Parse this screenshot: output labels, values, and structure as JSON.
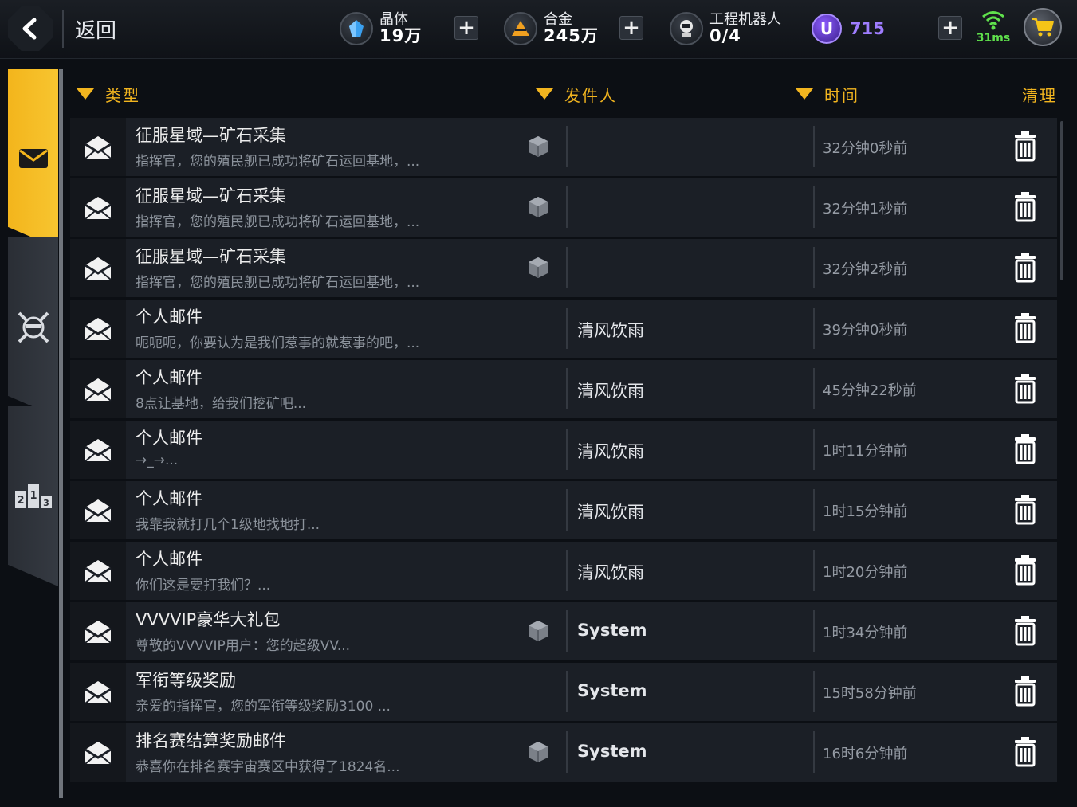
{
  "topbar": {
    "back_label": "返回",
    "crystal": {
      "name": "晶体",
      "value": "19万"
    },
    "alloy": {
      "name": "合金",
      "value": "245万"
    },
    "robot": {
      "name": "工程机器人",
      "value": "0/4"
    },
    "premium": {
      "icon_letter": "U",
      "value": "715"
    },
    "ping": "31ms",
    "colors": {
      "crystal": "#3aa0f0",
      "alloy": "#f0a020",
      "premium": "#9f7dff",
      "ping": "#5fe04c"
    }
  },
  "tabs": [
    {
      "icon": "envelope-icon",
      "active": true
    },
    {
      "icon": "crossed-swords-helmet-icon",
      "active": false
    },
    {
      "icon": "podium-rank-icon",
      "active": false
    }
  ],
  "header": {
    "type": "类型",
    "sender": "发件人",
    "time": "时间",
    "clear": "清理",
    "accent": "#f2b51f"
  },
  "mails": [
    {
      "subject": "征服星域—矿石采集",
      "preview": "指挥官，您的殖民舰已成功将矿石运回基地，...",
      "sender": "",
      "time": "32分钟0秒前",
      "attachment": true,
      "system": false
    },
    {
      "subject": "征服星域—矿石采集",
      "preview": "指挥官，您的殖民舰已成功将矿石运回基地，...",
      "sender": "",
      "time": "32分钟1秒前",
      "attachment": true,
      "system": false
    },
    {
      "subject": "征服星域—矿石采集",
      "preview": "指挥官，您的殖民舰已成功将矿石运回基地，...",
      "sender": "",
      "time": "32分钟2秒前",
      "attachment": true,
      "system": false
    },
    {
      "subject": "个人邮件",
      "preview": "呃呃呃，你要认为是我们惹事的就惹事的吧，...",
      "sender": "清风饮雨",
      "time": "39分钟0秒前",
      "attachment": false,
      "system": false
    },
    {
      "subject": "个人邮件",
      "preview": "8点让基地，给我们挖矿吧...",
      "sender": "清风饮雨",
      "time": "45分钟22秒前",
      "attachment": false,
      "system": false
    },
    {
      "subject": "个人邮件",
      "preview": "→_→...",
      "sender": "清风饮雨",
      "time": "1时11分钟前",
      "attachment": false,
      "system": false
    },
    {
      "subject": "个人邮件",
      "preview": "我靠我就打几个1级地找地打...",
      "sender": "清风饮雨",
      "time": "1时15分钟前",
      "attachment": false,
      "system": false
    },
    {
      "subject": "个人邮件",
      "preview": "你们这是要打我们？...",
      "sender": "清风饮雨",
      "time": "1时20分钟前",
      "attachment": false,
      "system": false
    },
    {
      "subject": "VVVVIP豪华大礼包",
      "preview": "尊敬的VVVVIP用户：您的超级VV...",
      "sender": "System",
      "time": "1时34分钟前",
      "attachment": true,
      "system": true
    },
    {
      "subject": "军衔等级奖励",
      "preview": "亲爱的指挥官，您的军衔等级奖励3100 ...",
      "sender": "System",
      "time": "15时58分钟前",
      "attachment": false,
      "system": true
    },
    {
      "subject": "排名赛结算奖励邮件",
      "preview": "恭喜你在排名赛宇宙赛区中获得了1824名...",
      "sender": "System",
      "time": "16时6分钟前",
      "attachment": true,
      "system": true
    }
  ]
}
